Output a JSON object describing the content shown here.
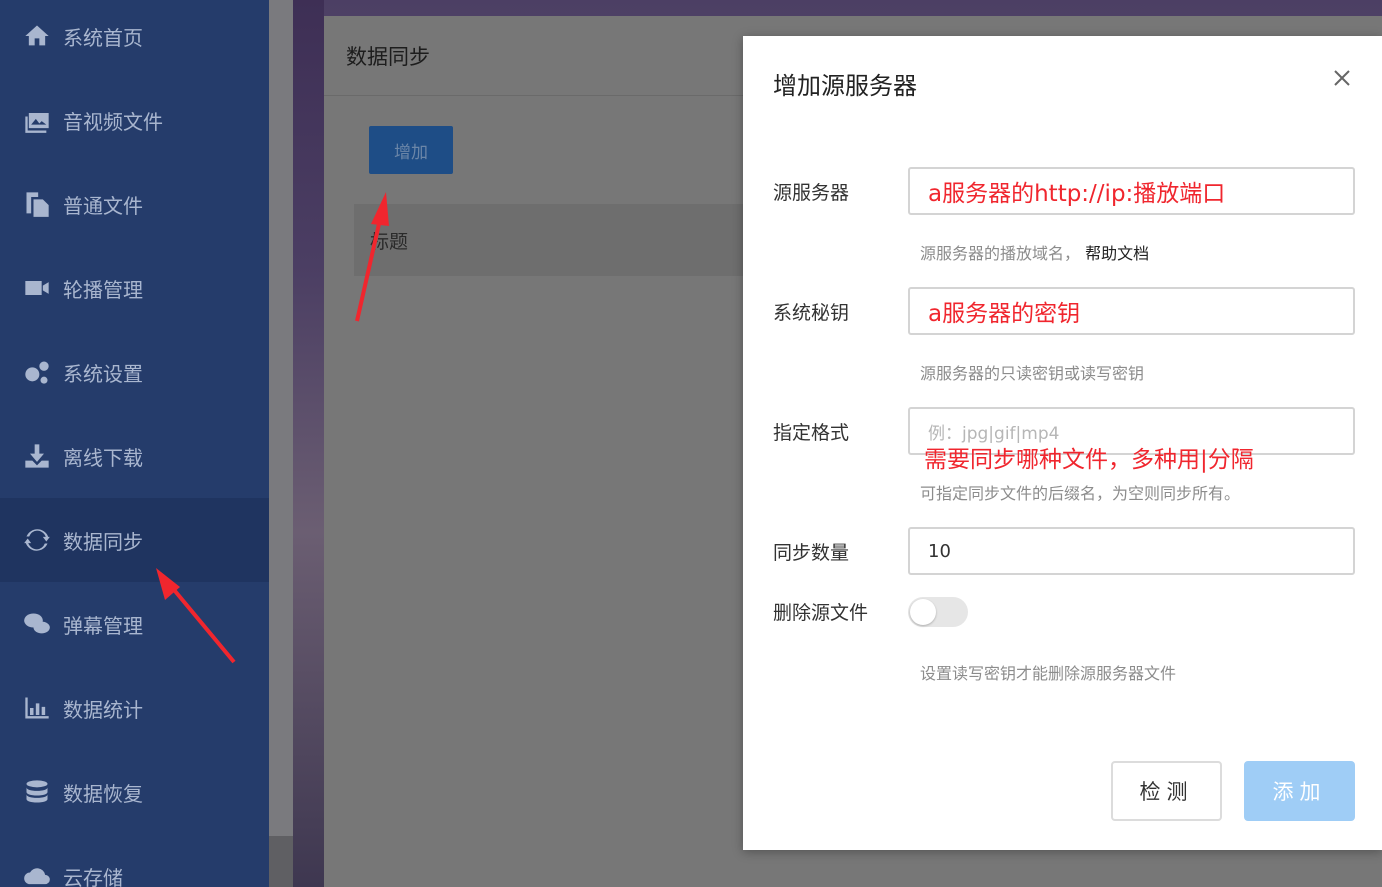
{
  "sidebar": {
    "items": [
      {
        "label": "系统首页",
        "icon": "home-icon"
      },
      {
        "label": "音视频文件",
        "icon": "media-icon"
      },
      {
        "label": "普通文件",
        "icon": "file-copy-icon"
      },
      {
        "label": "轮播管理",
        "icon": "video-camera-icon"
      },
      {
        "label": "系统设置",
        "icon": "gears-icon"
      },
      {
        "label": "离线下载",
        "icon": "download-icon"
      },
      {
        "label": "数据同步",
        "icon": "sync-icon"
      },
      {
        "label": "弹幕管理",
        "icon": "comments-icon"
      },
      {
        "label": "数据统计",
        "icon": "bar-chart-icon"
      },
      {
        "label": "数据恢复",
        "icon": "database-icon"
      },
      {
        "label": "云存储",
        "icon": "cloud-upload-icon"
      }
    ],
    "active": "数据同步"
  },
  "page": {
    "title": "数据同步",
    "add_button": "增加",
    "table_header": "标题"
  },
  "modal": {
    "title": "增加源服务器",
    "fields": {
      "source_server": {
        "label": "源服务器",
        "value": "a服务器的http://ip:播放端口",
        "hint": "源服务器的播放域名，",
        "help_link": "帮助文档"
      },
      "system_key": {
        "label": "系统秘钥",
        "value": "a服务器的密钥",
        "hint": "源服务器的只读密钥或读写密钥"
      },
      "format": {
        "label": "指定格式",
        "placeholder": "例：jpg|gif|mp4",
        "annotation": "需要同步哪种文件，多种用|分隔",
        "hint": "可指定同步文件的后缀名，为空则同步所有。"
      },
      "sync_count": {
        "label": "同步数量",
        "value": "10"
      },
      "delete_source": {
        "label": "删除源文件",
        "enabled": false,
        "hint": "设置读写密钥才能删除源服务器文件"
      }
    },
    "buttons": {
      "check": "检测",
      "add": "添加"
    }
  },
  "colors": {
    "sidebar_bg": "#253c6b",
    "annotation_red": "#f0262e",
    "add_button_disabled": "#9fcdf6"
  }
}
